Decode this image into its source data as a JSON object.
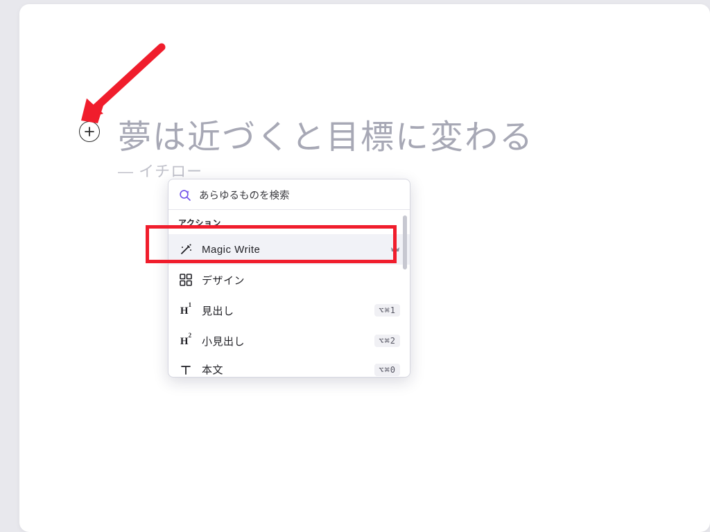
{
  "heading": "夢は近づくと目標に変わる",
  "subheading": "— イチロー",
  "menu": {
    "search_placeholder": "あらゆるものを検索",
    "section_label": "アクション",
    "items": [
      {
        "label": "Magic Write",
        "icon": "wand",
        "badge": "crown"
      },
      {
        "label": "デザイン",
        "icon": "grid"
      },
      {
        "label": "見出し",
        "icon": "h1",
        "shortcut": "⌥⌘1"
      },
      {
        "label": "小見出し",
        "icon": "h2",
        "shortcut": "⌥⌘2"
      },
      {
        "label": "本文",
        "icon": "text",
        "shortcut": "⌥⌘0"
      }
    ]
  },
  "colors": {
    "highlight": "#f01d2c",
    "arrow": "#f01d2c"
  }
}
